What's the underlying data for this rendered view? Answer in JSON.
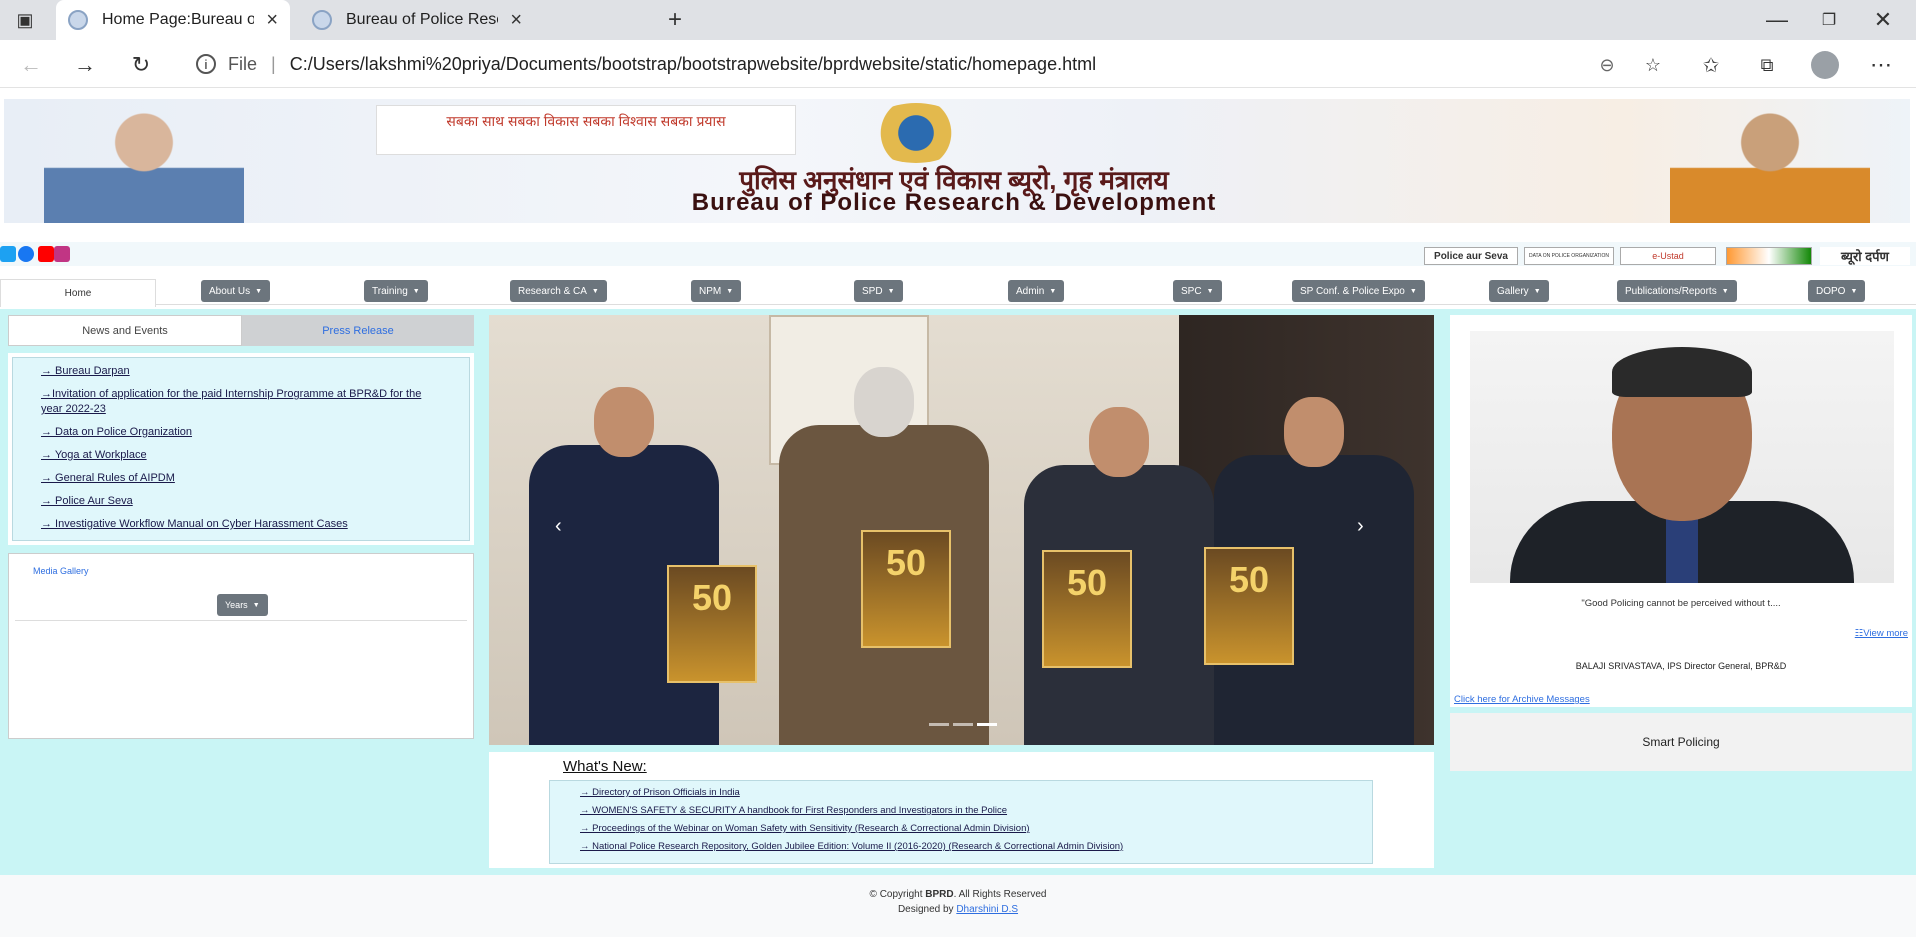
{
  "browser": {
    "tabs": [
      {
        "title": "Home Page:Bureau of Police Rese"
      },
      {
        "title": "Bureau of Police Research And D"
      }
    ],
    "new_tab": "+",
    "address": {
      "file_label": "File",
      "url": "C:/Users/lakshmi%20priya/Documents/bootstrap/bootstrapwebsite/bprdwebsite/static/homepage.html"
    }
  },
  "banner": {
    "slogan": "सबका साथ सबका विकास सबका विश्वास सबका प्रयास",
    "hindi_title": "पुलिस अनुसंधान एवं विकास ब्यूरो, गृह मंत्रालय",
    "english_title": "Bureau of Police Research & Development",
    "ministry": "Ministry of Home Affairs"
  },
  "partner_logos": [
    "Police aur Seva",
    "DATA ON POLICE ORGANIZATION",
    "e-Ustad",
    "",
    "ब्यूरो दर्पण"
  ],
  "nav": {
    "home": "Home",
    "menus": [
      "About Us",
      "Training",
      "Research & CA",
      "NPM",
      "SPD",
      "Admin",
      "SPC",
      "SP Conf. & Police Expo",
      "Gallery",
      "Publications/Reports",
      "DOPO"
    ]
  },
  "left": {
    "tab_news": "News and Events",
    "tab_press": "Press Release",
    "news": [
      "→ Bureau Darpan",
      "→Invitation of application for the paid Internship Programme at BPR&D for the year 2022-23",
      "→ Data on Police Organization",
      "→ Yoga at Workplace",
      "→ General Rules of AIPDM",
      "→ Police Aur Seva",
      "→ Investigative Workflow Manual on Cyber Harassment Cases"
    ],
    "media_gallery": "Media Gallery",
    "years_button": "Years"
  },
  "whats_new": {
    "heading": "What's New:",
    "items": [
      "→ Directory of Prison Officials in India",
      "→ WOMEN'S SAFETY & SECURITY A handbook for First Responders and Investigators in the Police",
      "→ Proceedings of the Webinar on Woman Safety with Sensitivity (Research & Correctional Admin Division)",
      "→ National Police Research Repository, Golden Jubilee Edition: Volume II (2016-2020) (Research & Correctional Admin Division)"
    ]
  },
  "right": {
    "quote": "\"Good Policing cannot be perceived without t....",
    "view_more": "☷View more",
    "dg_name": "BALAJI SRIVASTAVA, IPS Director General, BPR&D",
    "archive_link": "Click here for Archive Messages",
    "smart_policing": "Smart Policing"
  },
  "footer": {
    "copyright_prefix": "© Copyright ",
    "brand": "BPRD",
    "copyright_suffix": ". All Rights Reserved",
    "designed_by": "Designed by ",
    "designer": "Dharshini D.S"
  }
}
